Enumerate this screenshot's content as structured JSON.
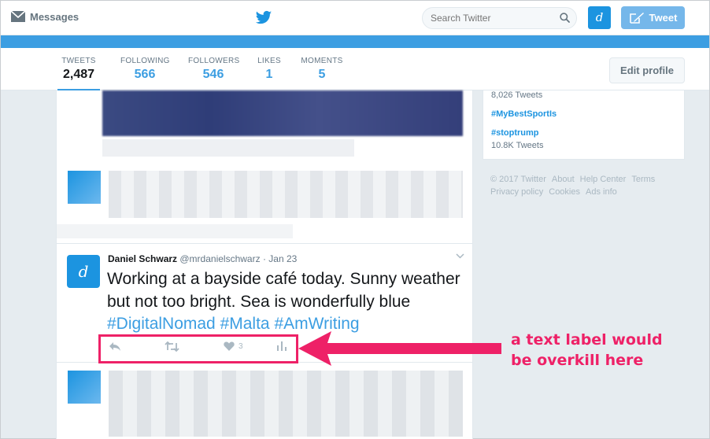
{
  "nav": {
    "messages_label": "Messages",
    "search_placeholder": "Search Twitter",
    "avatar_letter": "d",
    "tweet_button": "Tweet"
  },
  "profile_nav": {
    "stats": [
      {
        "label": "TWEETS",
        "value": "2,487"
      },
      {
        "label": "FOLLOWING",
        "value": "566"
      },
      {
        "label": "FOLLOWERS",
        "value": "546"
      },
      {
        "label": "LIKES",
        "value": "1"
      },
      {
        "label": "MOMENTS",
        "value": "5"
      }
    ],
    "edit_profile": "Edit profile"
  },
  "trends": {
    "items": [
      {
        "count": "8,026 Tweets"
      },
      {
        "tag": "#MyBestSportIs"
      },
      {
        "tag": "#stoptrump",
        "count": "10.8K Tweets"
      }
    ]
  },
  "footer": {
    "links": [
      "© 2017 Twitter",
      "About",
      "Help Center",
      "Terms",
      "Privacy policy",
      "Cookies",
      "Ads info"
    ]
  },
  "tweet": {
    "avatar_letter": "d",
    "name": "Daniel Schwarz",
    "handle": "@mrdanielschwarz",
    "date": "· Jan 23",
    "text_plain": "Working at a bayside café today. Sunny weather but not too bright. Sea is wonderfully blue ",
    "hashtags": [
      "#DigitalNomad",
      "#Malta",
      "#AmWriting"
    ],
    "like_count": "3"
  },
  "annotation": {
    "line1": "a text label would",
    "line2": "be overkill here"
  },
  "colors": {
    "twitter_blue": "#1c94e0",
    "banner_blue": "#3c9ee2",
    "annotation_pink": "#ee2167"
  }
}
